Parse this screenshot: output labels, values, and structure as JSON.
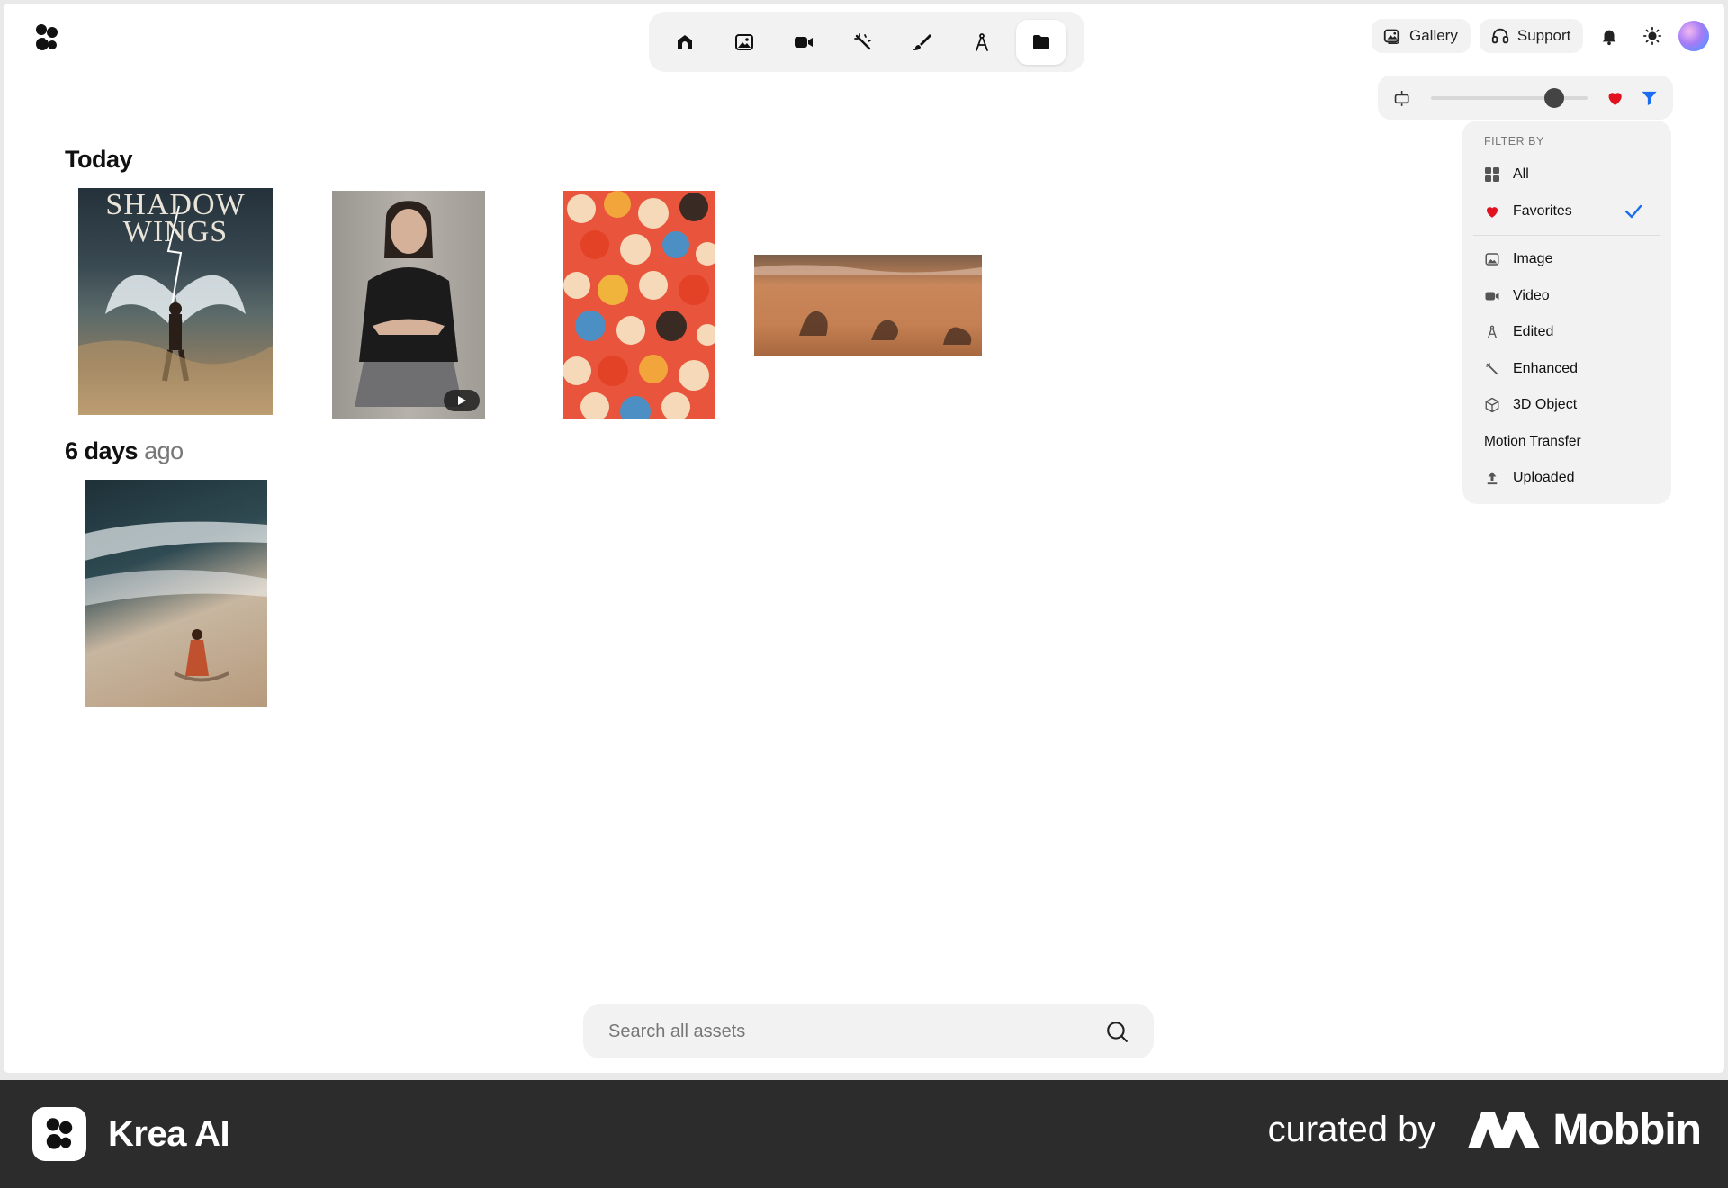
{
  "nav": {
    "items": [
      {
        "name": "home",
        "icon": "home-icon"
      },
      {
        "name": "image",
        "icon": "image-icon"
      },
      {
        "name": "video",
        "icon": "video-icon"
      },
      {
        "name": "enhance",
        "icon": "magic-wand-icon"
      },
      {
        "name": "edit",
        "icon": "brush-icon"
      },
      {
        "name": "train",
        "icon": "compass-icon"
      },
      {
        "name": "assets",
        "icon": "folder-icon",
        "active": true
      }
    ]
  },
  "header": {
    "gallery_label": "Gallery",
    "support_label": "Support"
  },
  "toolbar": {
    "size_level": 0.76,
    "heart_color": "#e1121d",
    "filter_color": "#1a6cf0"
  },
  "filter": {
    "title": "FILTER BY",
    "items": [
      {
        "label": "All",
        "icon": "grid-icon"
      },
      {
        "label": "Favorites",
        "icon": "heart-icon",
        "checked": true
      },
      {
        "label": "Image",
        "icon": "image-icon"
      },
      {
        "label": "Video",
        "icon": "video-icon"
      },
      {
        "label": "Edited",
        "icon": "compass-icon"
      },
      {
        "label": "Enhanced",
        "icon": "magic-wand-icon"
      },
      {
        "label": "3D Object",
        "icon": "cube-icon"
      },
      {
        "label": "Motion Transfer",
        "icon": ""
      },
      {
        "label": "Uploaded",
        "icon": "upload-icon"
      }
    ]
  },
  "sections": {
    "today": "Today",
    "six_days_num": "6 days",
    "six_days_suffix": "ago"
  },
  "assets": {
    "poster_title_line1": "SHADOW",
    "poster_title_line2": "WINGS"
  },
  "search": {
    "placeholder": "Search all assets"
  },
  "footer": {
    "brand": "Krea AI",
    "curated": "curated by",
    "mobbin": "Mobbin"
  }
}
